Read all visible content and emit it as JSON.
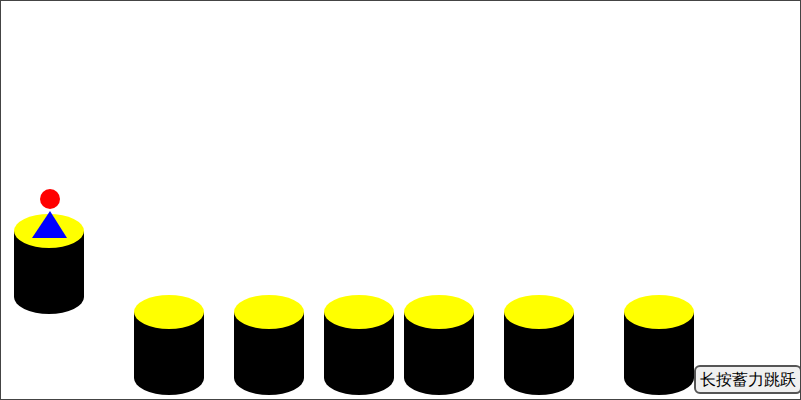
{
  "platforms": [
    {
      "current": true
    },
    {
      "current": false
    },
    {
      "current": false
    },
    {
      "current": false
    },
    {
      "current": false
    },
    {
      "current": false
    },
    {
      "current": false
    }
  ],
  "button": "长按蓄力跳跃"
}
